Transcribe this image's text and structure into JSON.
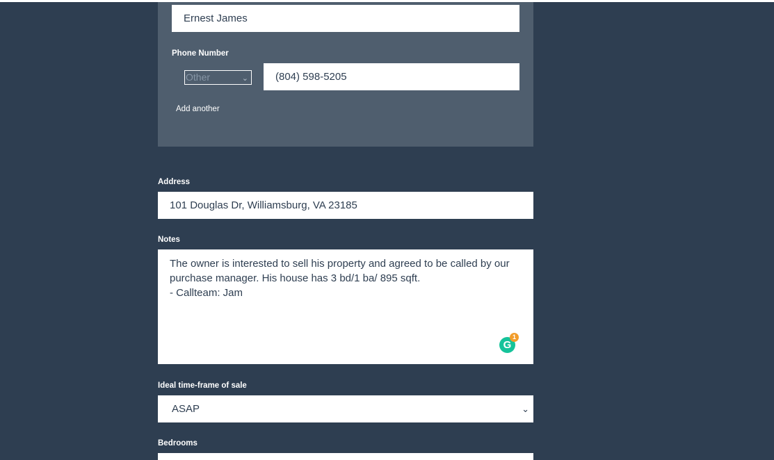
{
  "contact": {
    "name_value": "Ernest James",
    "phone_label": "Phone Number",
    "phone_type_value": "Other",
    "phone_value": "(804) 598-5205",
    "add_another_label": "Add another"
  },
  "address": {
    "label": "Address",
    "value": "101 Douglas Dr, Williamsburg, VA 23185"
  },
  "notes": {
    "label": "Notes",
    "lines": [
      "The owner is interested to sell his property and agreed to be called by our",
      "purchase manager. His house has 3 bd/1 ba/ 895 sqft.",
      "- Callteam: Jam"
    ],
    "grammarly_icon": "G",
    "grammarly_count": "1"
  },
  "timeframe": {
    "label": "Ideal time-frame of sale",
    "value": "ASAP"
  },
  "bedrooms": {
    "label": "Bedrooms"
  },
  "colors": {
    "background": "#2e3e51",
    "contact_panel": "#4f5e6e",
    "grammarly": "#15c39a",
    "badge": "#f29d2b"
  }
}
